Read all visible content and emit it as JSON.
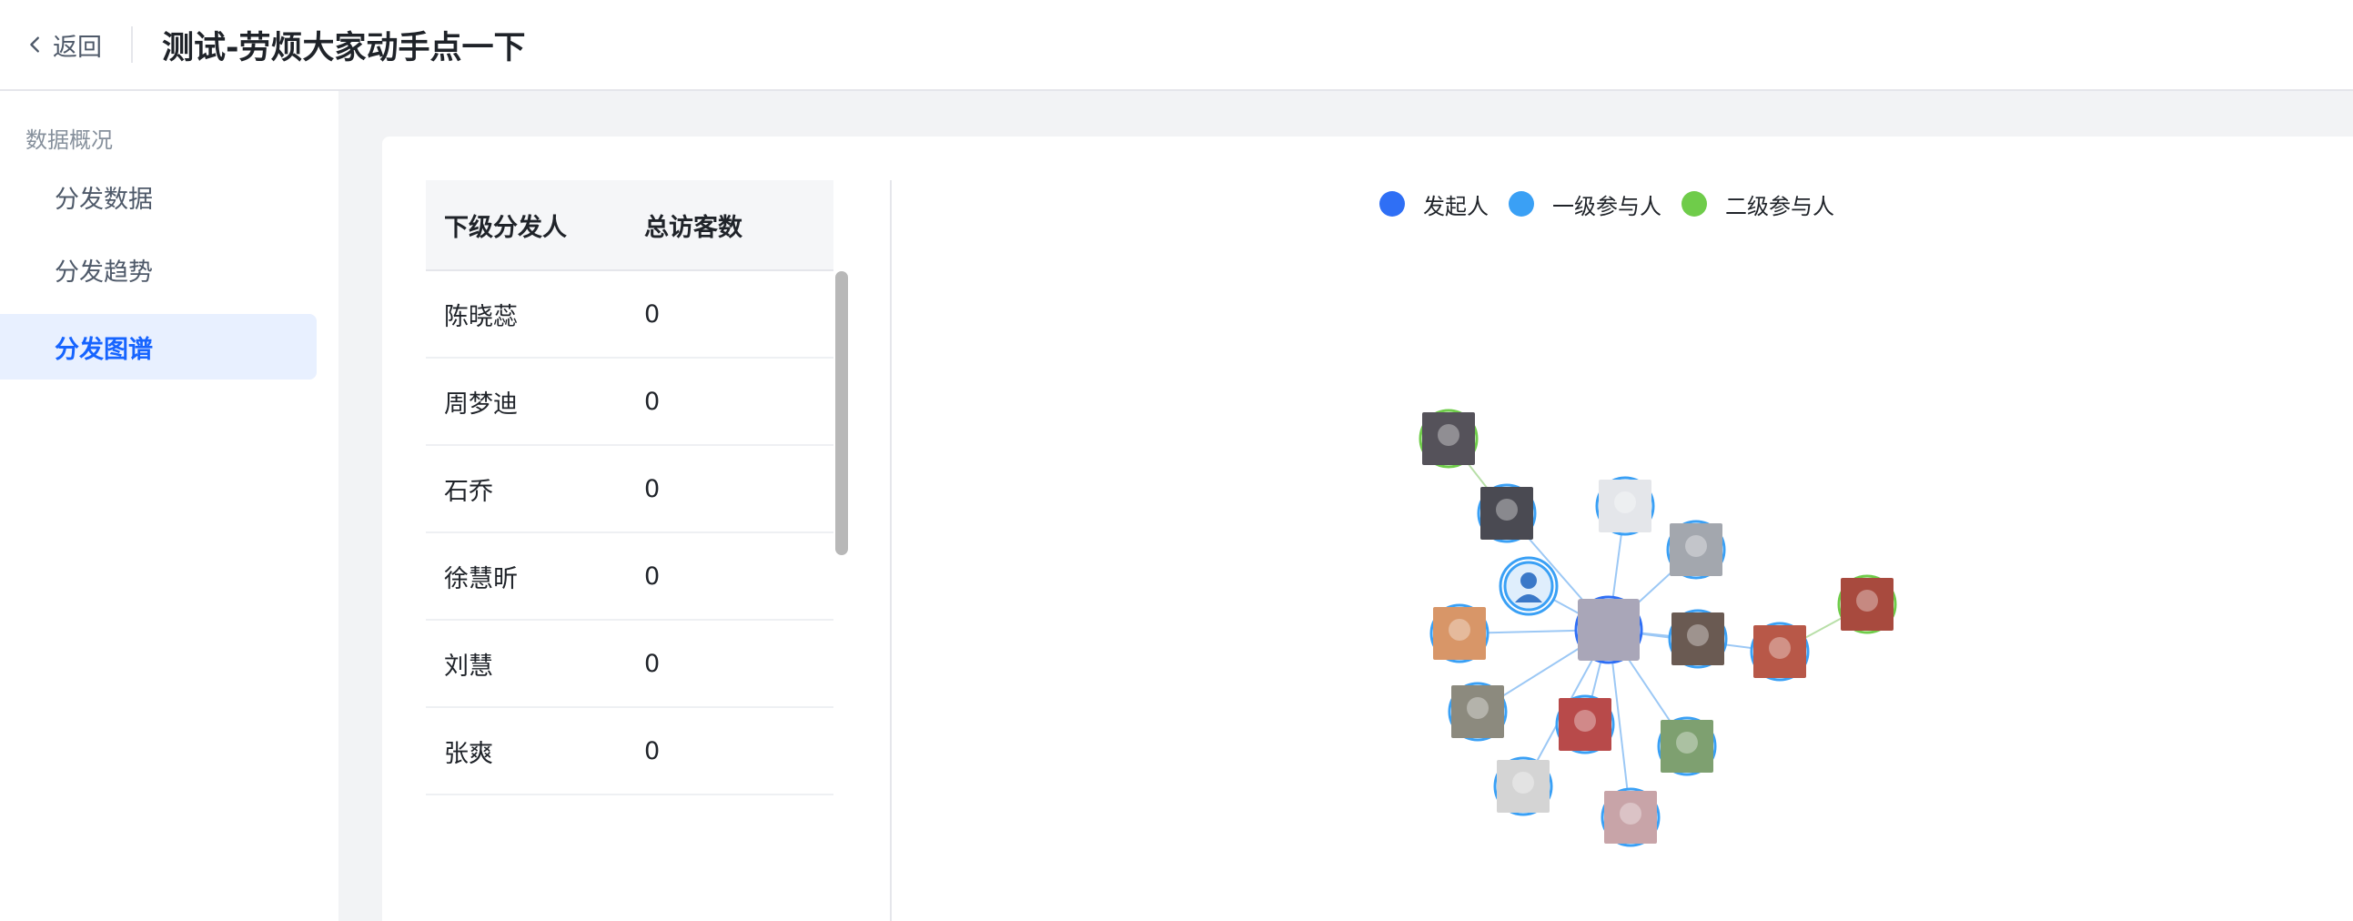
{
  "header": {
    "back_label": "返回",
    "title": "测试-劳烦大家动手点一下"
  },
  "sidebar": {
    "group_label": "数据概况",
    "items": [
      {
        "label": "分发数据",
        "active": false
      },
      {
        "label": "分发趋势",
        "active": false
      },
      {
        "label": "分发图谱",
        "active": true
      }
    ]
  },
  "table": {
    "columns": [
      "下级分发人",
      "总访客数"
    ],
    "rows": [
      {
        "name": "陈晓蕊",
        "visitors": "0"
      },
      {
        "name": "周梦迪",
        "visitors": "0"
      },
      {
        "name": "石乔",
        "visitors": "0"
      },
      {
        "name": "徐慧昕",
        "visitors": "0"
      },
      {
        "name": "刘慧",
        "visitors": "0"
      },
      {
        "name": "张爽",
        "visitors": "0"
      }
    ]
  },
  "legend": [
    {
      "label": "发起人",
      "color": "#2f6ff5"
    },
    {
      "label": "一级参与人",
      "color": "#3aa0f5"
    },
    {
      "label": "二级参与人",
      "color": "#6fcc4a"
    }
  ],
  "colors": {
    "accent": "#1664ff",
    "initiator": "#2f6ff5",
    "level1": "#3aa0f5",
    "level2": "#6fcc4a",
    "edge_level1": "#9cc8f5",
    "edge_level2": "#b8dfa8"
  },
  "graph": {
    "center": {
      "role": "initiator"
    },
    "nodes": [
      {
        "id": "n1",
        "role": "level1",
        "avatar": "avatar-dark-suit"
      },
      {
        "id": "n2",
        "role": "level1",
        "avatar": "avatar-default-person-icon"
      },
      {
        "id": "n3",
        "role": "level1",
        "avatar": "avatar-light-shirt"
      },
      {
        "id": "n4",
        "role": "level1",
        "avatar": "avatar-gray-room"
      },
      {
        "id": "n5",
        "role": "level1",
        "avatar": "avatar-orange-photo"
      },
      {
        "id": "n6",
        "role": "level1",
        "avatar": "avatar-face-dark-hair"
      },
      {
        "id": "n7",
        "role": "level1",
        "avatar": "avatar-red-tile"
      },
      {
        "id": "n8",
        "role": "level1",
        "avatar": "avatar-street"
      },
      {
        "id": "n9",
        "role": "level1",
        "avatar": "avatar-red-dress"
      },
      {
        "id": "n10",
        "role": "level1",
        "avatar": "avatar-landscape"
      },
      {
        "id": "n11",
        "role": "level1",
        "avatar": "avatar-white-blur"
      },
      {
        "id": "n12",
        "role": "level1",
        "avatar": "avatar-pink-blur"
      },
      {
        "id": "n13",
        "role": "level2",
        "avatar": "avatar-dark-suit-2",
        "parent": "n1"
      },
      {
        "id": "n14",
        "role": "level2",
        "avatar": "avatar-red-abstract",
        "parent": "n7"
      }
    ]
  }
}
